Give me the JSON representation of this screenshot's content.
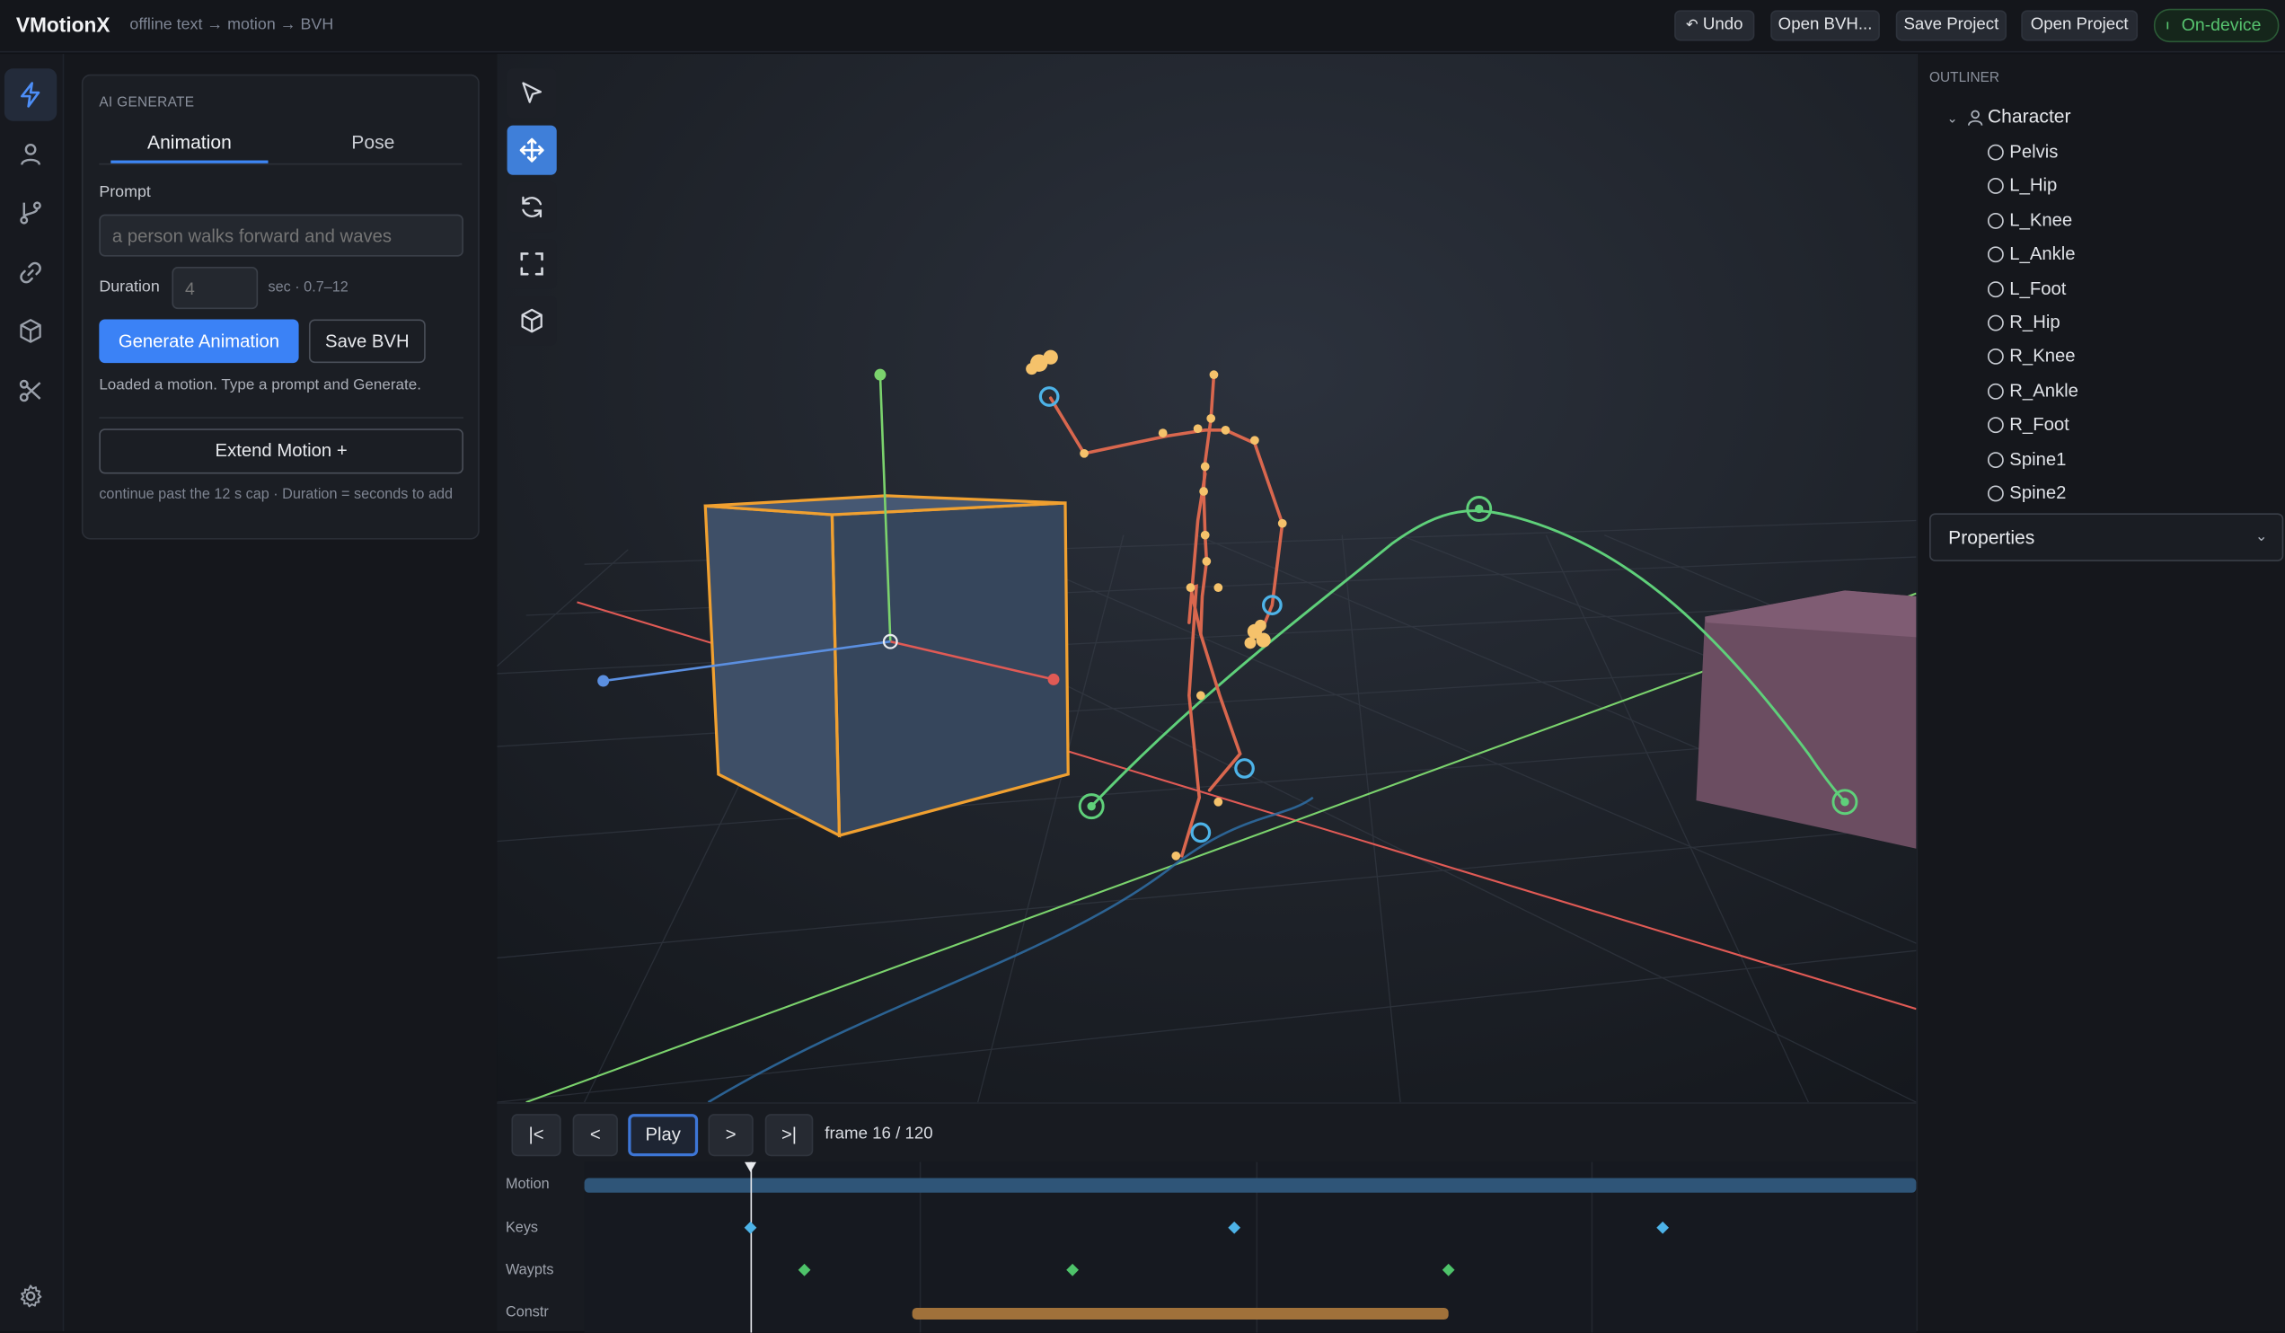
{
  "app": {
    "brand": "VMotionX",
    "subtitle": "offline text → motion → BVH"
  },
  "toolbar": {
    "undo": "Undo",
    "open_bvh": "Open BVH...",
    "save_project": "Save Project",
    "open_project": "Open Project",
    "on_device": "On-device"
  },
  "rail": {
    "items": [
      "bolt-icon",
      "person-icon",
      "branch-icon",
      "link-icon",
      "cube-icon",
      "scissors-icon"
    ],
    "settings": "gear-icon"
  },
  "ai_generate": {
    "title": "AI GENERATE",
    "tabs": [
      "Animation",
      "Pose"
    ],
    "active_tab": "Animation",
    "prompt_label": "Prompt",
    "prompt_placeholder": "a person walks forward and waves",
    "duration_label": "Duration",
    "duration_placeholder": "4",
    "duration_hint": "sec · 0.7–12",
    "generate_button": "Generate Animation",
    "save_bvh_button": "Save BVH",
    "status": "Loaded a motion. Type a prompt and Generate.",
    "extend_button": "Extend Motion +",
    "extend_hint": "continue past the 12 s cap · Duration = seconds to add"
  },
  "viewport": {
    "tools": [
      "select-icon",
      "move-icon",
      "rotate-icon",
      "scale-icon",
      "cube-icon"
    ],
    "active_tool": "move-icon",
    "colors": {
      "selected_outline": "#f0a030",
      "skeleton": "#d9674e",
      "joint": "#f5c26b",
      "path": "#5fd07a",
      "axis_x": "#e05a55",
      "axis_y": "#7bd36d",
      "axis_z": "#5b8fe0"
    }
  },
  "timeline": {
    "buttons": [
      "|<",
      "<",
      "Play",
      ">",
      ">|"
    ],
    "frame_label": "frame 16 / 120",
    "current_frame": 16,
    "total_frames": 120,
    "tracks": [
      "Motion",
      "Keys",
      "Waypts",
      "Constr"
    ],
    "key_frames": [
      16,
      61,
      101
    ],
    "waypoint_frames": [
      21,
      46,
      81
    ],
    "constraint_range": [
      31,
      81
    ]
  },
  "outliner": {
    "title": "OUTLINER",
    "root": "Character",
    "bones": [
      "Pelvis",
      "L_Hip",
      "L_Knee",
      "L_Ankle",
      "L_Foot",
      "R_Hip",
      "R_Knee",
      "R_Ankle",
      "R_Foot",
      "Spine1",
      "Spine2"
    ],
    "properties": "Properties"
  }
}
